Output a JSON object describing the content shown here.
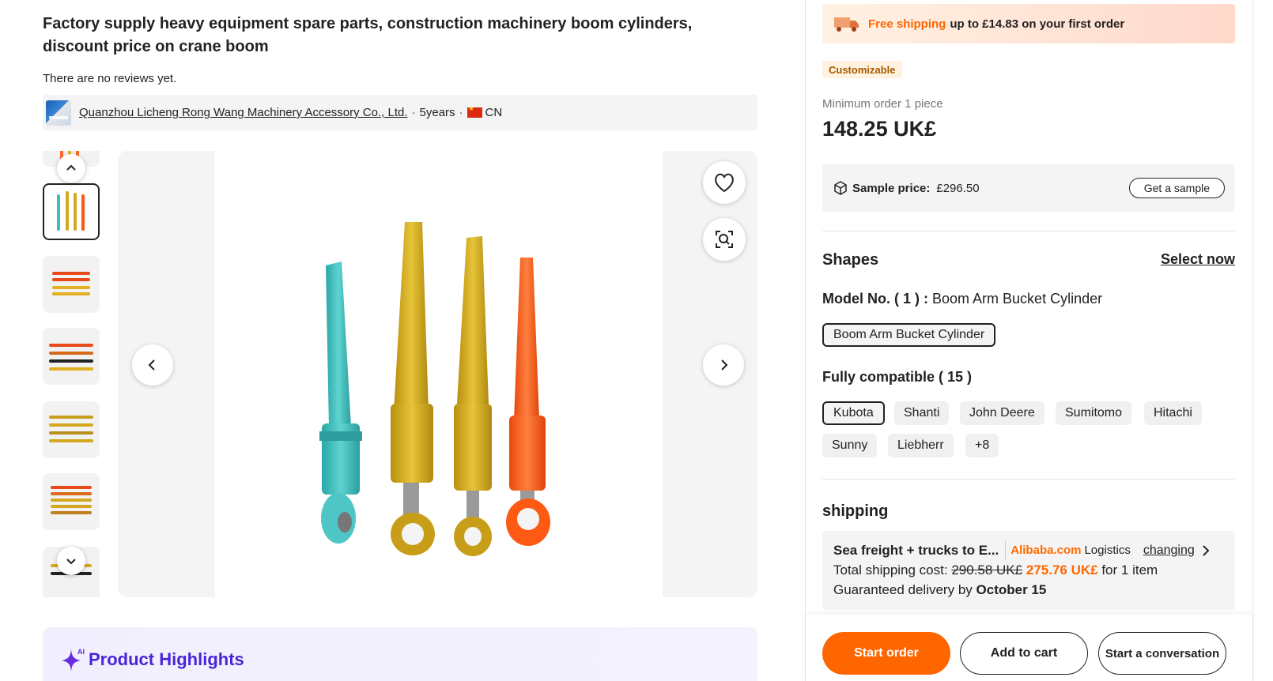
{
  "product": {
    "title": "Factory supply heavy equipment spare parts, construction machinery boom cylinders, discount price on crane boom",
    "reviews": "There are no reviews yet."
  },
  "supplier": {
    "name": "Quanzhou Licheng Rong Wang Machinery Accessory Co., Ltd.",
    "years": "5years",
    "country": "CN",
    "separator": "·"
  },
  "gallery": {
    "thumbnail_count": 7,
    "active_index": 1
  },
  "highlights": {
    "title": "Product Highlights",
    "ai_tag": "AI"
  },
  "shipping_banner": {
    "highlight": "Free shipping",
    "text": "up to £14.83 on your first order"
  },
  "badge": "Customizable",
  "pricing": {
    "min_order": "Minimum order 1 piece",
    "price": "148.25 UK£"
  },
  "sample": {
    "label": "Sample price:",
    "value": "£296.50",
    "button": "Get a sample"
  },
  "shapes": {
    "title": "Shapes",
    "select_now": "Select now",
    "model_label": "Model No. ( 1 ) :",
    "model_value": "Boom Arm Bucket Cylinder",
    "model_chip": "Boom Arm Bucket Cylinder",
    "compat_title": "Fully compatible ( 15 )",
    "compat": [
      "Kubota",
      "Shanti",
      "John Deere",
      "Sumitomo",
      "Hitachi",
      "Sunny",
      "Liebherr",
      "+8"
    ]
  },
  "shipping": {
    "title": "shipping",
    "method": "Sea freight + trucks to E...",
    "provider": "Alibaba.com",
    "provider_suffix": "Logistics",
    "changing": "changing",
    "cost_label": "Total shipping cost:",
    "old_cost": "290.58 UK£",
    "new_cost": "275.76 UK£",
    "cost_suffix": "for 1 item",
    "delivery_label": "Guaranteed delivery by",
    "delivery_date": "October 15"
  },
  "actions": {
    "start_order": "Start order",
    "add_to_cart": "Add to cart",
    "start_conversation": "Start a conversation"
  },
  "colors": {
    "accent": "#ff6600",
    "highlight_purple": "#4a25d8",
    "teal_cylinder": "#3bbfbf",
    "yellow_cylinder": "#d4a820",
    "orange_cylinder": "#ff5a14"
  },
  "icons": [
    "chevron-up-icon",
    "chevron-down-icon",
    "chevron-left-icon",
    "chevron-right-icon",
    "heart-icon",
    "image-search-icon",
    "cube-icon",
    "truck-icon",
    "sparkle-icon",
    "chevron-right-small-icon"
  ]
}
